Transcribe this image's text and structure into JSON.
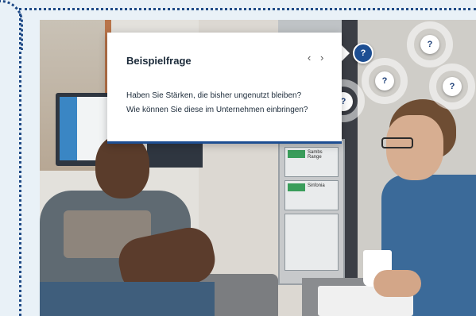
{
  "popup": {
    "title": "Beispielfrage",
    "prev_icon": "‹",
    "next_icon": "›",
    "line1": "Haben Sie Stärken, die bisher ungenutzt bleiben?",
    "line2": "Wie können Sie diese im Unternehmen einbringen?"
  },
  "hotspots": {
    "active": "?",
    "h1": "?",
    "h2": "?",
    "h3": "?",
    "h4": "?"
  },
  "scene": {
    "brochure1": "Sambs Range",
    "brochure2": "Sinfonia"
  },
  "colors": {
    "accent": "#1d4e92",
    "dotted_border": "#1f4a86"
  }
}
